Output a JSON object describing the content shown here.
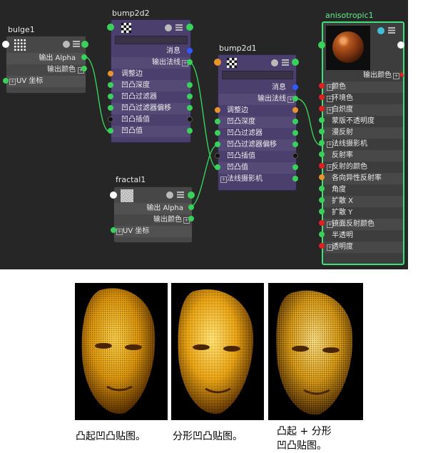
{
  "nodes": {
    "bulge": {
      "title": "bulge1",
      "rows": [
        "输出 Alpha",
        "输出颜色",
        "UV 坐标"
      ]
    },
    "bump2d2": {
      "title": "bump2d2",
      "rows": [
        "消息",
        "输出法线",
        "调整边",
        "凹凸深度",
        "凹凸过滤器",
        "凹凸过滤器偏移",
        "凹凸插值",
        "凹凸值"
      ]
    },
    "bump2d1": {
      "title": "bump2d1",
      "rows": [
        "消息",
        "输出法线",
        "调整边",
        "凹凸深度",
        "凹凸过滤器",
        "凹凸过滤器偏移",
        "凹凸插值",
        "凹凸值",
        "法线摄影机"
      ]
    },
    "fractal": {
      "title": "fractal1",
      "rows": [
        "输出 Alpha",
        "输出颜色",
        "UV 坐标"
      ]
    },
    "aniso": {
      "title": "anisotropic1",
      "out_label": "输出颜色",
      "rows": [
        "颜色",
        "环境色",
        "白炽度",
        "蒙版不透明度",
        "漫反射",
        "法线摄影机",
        "反射率",
        "反射的颜色",
        "各向异性反射率",
        "角度",
        "扩散 X",
        "扩散 Y",
        "镜面反射颜色",
        "半透明",
        "透明度"
      ]
    }
  },
  "colors": {
    "green": "#3ad15a",
    "orange": "#e8942c",
    "blue": "#2e5cff",
    "red": "#e02020",
    "purple": "#4b3f6e"
  },
  "captions": {
    "bulge": "凸起凹凸贴图。",
    "fractal": "分形凹凸贴图。",
    "combined_line1": "凸起 + 分形",
    "combined_line2": "凹凸贴图。"
  }
}
